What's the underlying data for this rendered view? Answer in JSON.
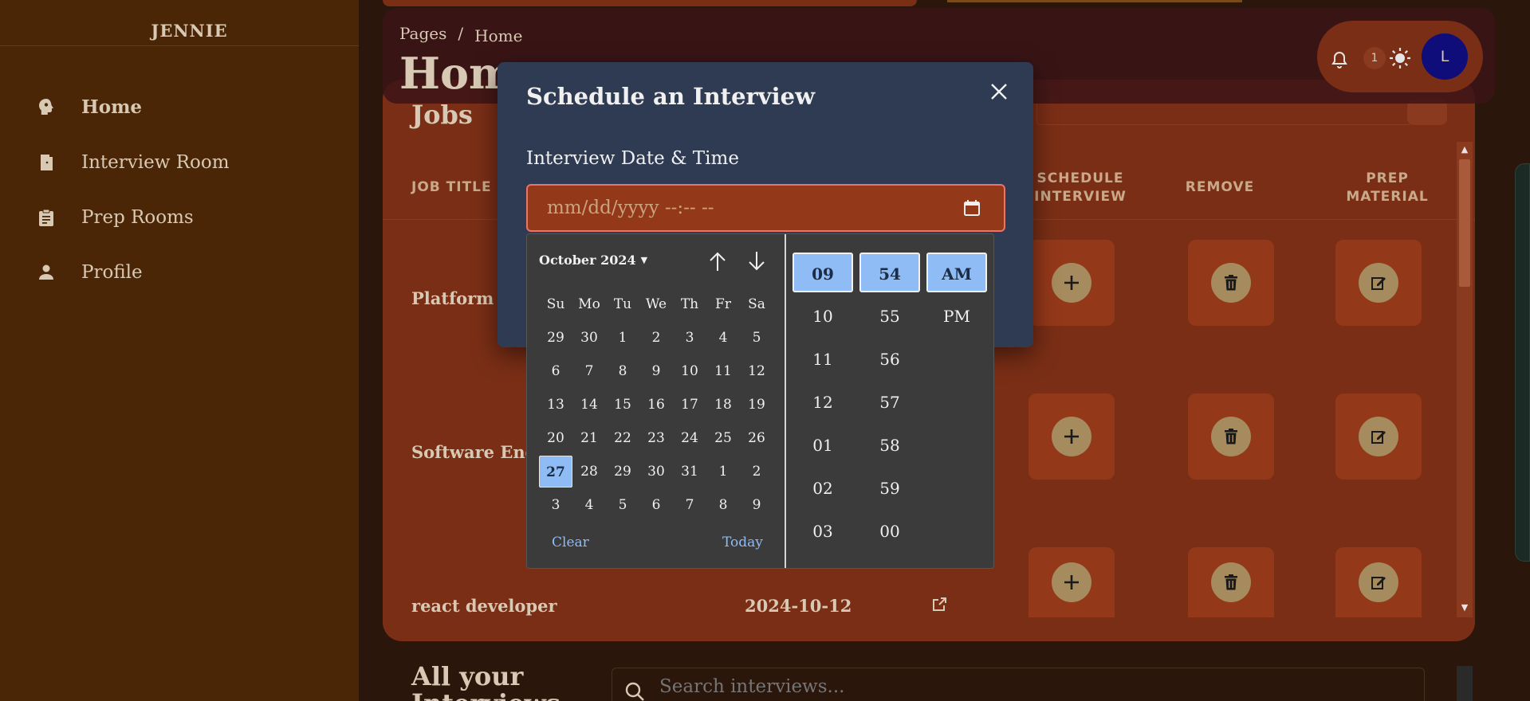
{
  "sidebar": {
    "brand": "JENNIE",
    "items": [
      {
        "label": "Home",
        "icon": "brain-head-icon"
      },
      {
        "label": "Interview Room",
        "icon": "door-icon"
      },
      {
        "label": "Prep Rooms",
        "icon": "clipboard-icon"
      },
      {
        "label": "Profile",
        "icon": "person-icon"
      }
    ]
  },
  "header": {
    "breadcrumb": [
      "Pages",
      "/",
      "Home"
    ],
    "title": "Home",
    "notification_count": "1",
    "avatar_initial": "L"
  },
  "jobs": {
    "title": "Jobs",
    "columns": [
      "JOB TITLE",
      "SCHEDULE INTERVIEW",
      "REMOVE",
      "PREP MATERIAL"
    ],
    "rows": [
      {
        "title": "Platform E",
        "date": ""
      },
      {
        "title": "Software Engin",
        "date": ""
      },
      {
        "title": "react developer",
        "date": "2024-10-12"
      }
    ]
  },
  "interviews": {
    "title": "All your Interviews",
    "search_placeholder": "Search interviews..."
  },
  "modal": {
    "title": "Schedule an Interview",
    "field_label": "Interview Date & Time",
    "input_placeholder": "mm/dd/yyyy --:-- --"
  },
  "datepicker": {
    "month": "October 2024",
    "weekdays": [
      "Su",
      "Mo",
      "Tu",
      "We",
      "Th",
      "Fr",
      "Sa"
    ],
    "weeks": [
      [
        "29",
        "30",
        "1",
        "2",
        "3",
        "4",
        "5"
      ],
      [
        "6",
        "7",
        "8",
        "9",
        "10",
        "11",
        "12"
      ],
      [
        "13",
        "14",
        "15",
        "16",
        "17",
        "18",
        "19"
      ],
      [
        "20",
        "21",
        "22",
        "23",
        "24",
        "25",
        "26"
      ],
      [
        "27",
        "28",
        "29",
        "30",
        "31",
        "1",
        "2"
      ],
      [
        "3",
        "4",
        "5",
        "6",
        "7",
        "8",
        "9"
      ]
    ],
    "selected_day": "27",
    "clear_label": "Clear",
    "today_label": "Today",
    "hours": [
      "09",
      "10",
      "11",
      "12",
      "01",
      "02",
      "03"
    ],
    "minutes": [
      "54",
      "55",
      "56",
      "57",
      "58",
      "59",
      "00"
    ],
    "periods": [
      "AM",
      "PM"
    ],
    "selected_hour": "09",
    "selected_minute": "54",
    "selected_period": "AM",
    "selected_color": "#8fbcf5"
  }
}
